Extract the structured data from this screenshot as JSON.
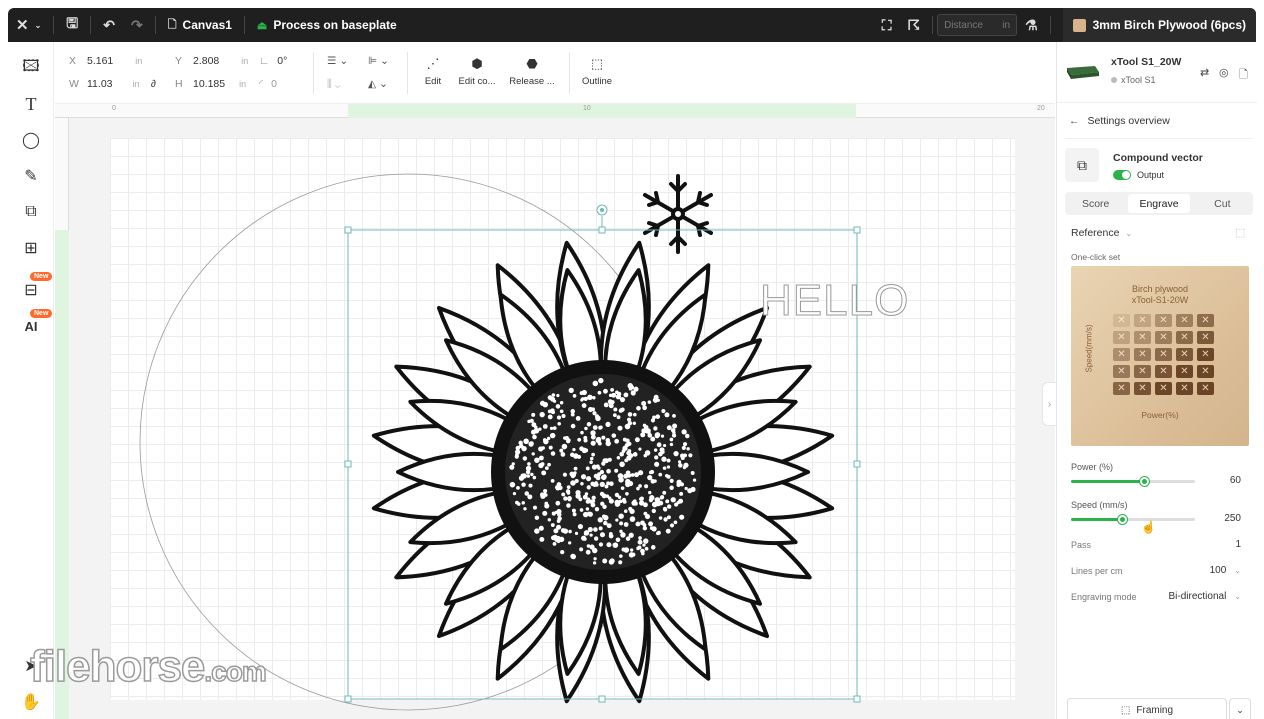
{
  "topbar": {
    "file_name": "Canvas1",
    "process_label": "Process on baseplate",
    "distance_placeholder": "Distance",
    "distance_unit": "in",
    "material": "3mm Birch Plywood (6pcs)"
  },
  "lefttools": {
    "badge_new": "New",
    "badge_new2": "New"
  },
  "props": {
    "x_label": "X",
    "x_value": "5.161",
    "x_unit": "in",
    "y_label": "Y",
    "y_value": "2.808",
    "y_unit": "in",
    "w_label": "W",
    "w_value": "11.03",
    "w_unit": "in",
    "h_label": "H",
    "h_value": "10.185",
    "h_unit": "in",
    "angle_value": "0°",
    "radius_value": "0",
    "edit_label": "Edit",
    "edit_compound_label": "Edit co...",
    "release_label": "Release ...",
    "outline_label": "Outline"
  },
  "ruler": {
    "t0": "0",
    "t10": "10",
    "t20": "20"
  },
  "canvas": {
    "hello_text": "HELLO"
  },
  "watermark": {
    "brand": "filehorse",
    "tld": ".com"
  },
  "device": {
    "name": "xTool S1_20W",
    "model": "xTool S1"
  },
  "settings": {
    "back_title": "Settings overview",
    "object_type": "Compound vector",
    "output_label": "Output",
    "tabs": [
      "Score",
      "Engrave",
      "Cut"
    ],
    "active_tab": "Engrave",
    "reference_label": "Reference",
    "one_click_label": "One-click set",
    "preset_title_line1": "Birch plywood",
    "preset_title_line2": "xTool-S1-20W",
    "preset_speed_axis": "Speed(mm/s)",
    "preset_power_axis": "Power(%)",
    "power_label": "Power (%)",
    "power_value": "60",
    "power_fraction": 0.6,
    "speed_label": "Speed (mm/s)",
    "speed_value": "250",
    "speed_fraction": 0.42,
    "pass_label": "Pass",
    "pass_value": "1",
    "lines_label": "Lines per cm",
    "lines_value": "100",
    "mode_label": "Engraving mode",
    "mode_value": "Bi-directional",
    "framing_label": "Framing"
  },
  "colors": {
    "accent": "#2ab24b",
    "topbar": "#1f1f1f",
    "selection": "#6fb8b8",
    "new_badge": "#ff6a2b"
  }
}
